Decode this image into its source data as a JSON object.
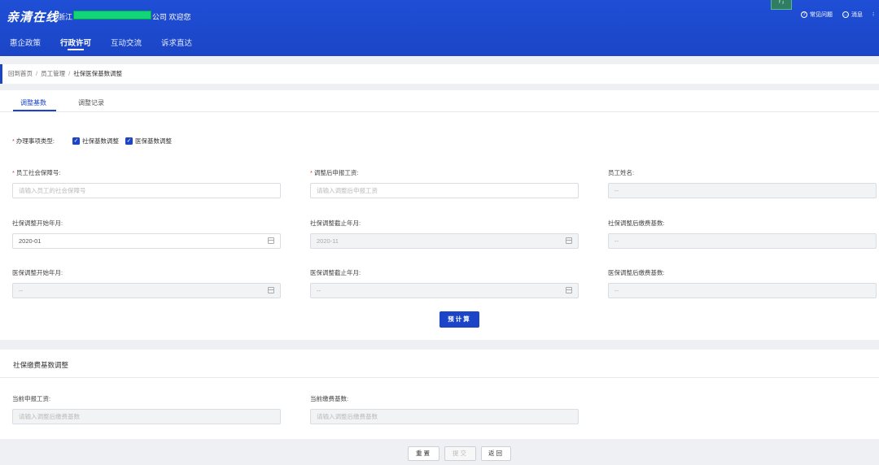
{
  "header": {
    "brand": "亲清在线",
    "dot": "•",
    "greeting_prefix": "浙江",
    "greeting_suffix": "公司 欢迎您",
    "links": [
      {
        "icon": "question-icon",
        "label": "常见问题"
      },
      {
        "icon": "message-icon",
        "label": "消息"
      }
    ],
    "floating_badge": "ᶠ ᶡ",
    "nav": [
      "惠企政策",
      "行政许可",
      "互动交流",
      "诉求直达"
    ],
    "nav_active": "行政许可"
  },
  "breadcrumb": {
    "items": [
      "回到首页",
      "员工管理",
      "社保医保基数调整"
    ],
    "separator": "/"
  },
  "tabs": [
    {
      "label": "调整基数",
      "active": true
    },
    {
      "label": "调整记录",
      "active": false
    }
  ],
  "form": {
    "type_label": "办理事项类型:",
    "checkboxes": [
      {
        "label": "社保基数调整",
        "checked": true
      },
      {
        "label": "医保基数调整",
        "checked": true
      }
    ],
    "ssn_label": "员工社会保障号:",
    "ssn_placeholder": "请输入员工的社会保障号",
    "wage_label": "调整后申报工资:",
    "wage_placeholder": "请输入调整后申报工资",
    "name_label": "员工姓名:",
    "name_value": "--",
    "si_start_label": "社保调整开始年月:",
    "si_start_value": "2020-01",
    "si_end_label": "社保调整截止年月:",
    "si_end_value": "2020-11",
    "si_base_label": "社保调整后缴费基数:",
    "si_base_value": "--",
    "mi_start_label": "医保调整开始年月:",
    "mi_start_value": "--",
    "mi_end_label": "医保调整截止年月:",
    "mi_end_value": "--",
    "mi_base_label": "医保调整后缴费基数:",
    "mi_base_value": "--",
    "calc_button": "预计算"
  },
  "section2": {
    "title": "社保缴费基数调整",
    "current_wage_label": "当前申报工资:",
    "current_wage_placeholder": "请输入调整后缴费基数",
    "current_base_label": "当前缴费基数:",
    "current_base_placeholder": "请输入调整后缴费基数"
  },
  "footer": {
    "reset": "重置",
    "submit": "提交",
    "back": "返回"
  },
  "colors": {
    "primary": "#1b45c6",
    "required": "#e53935",
    "redaction": "#12d57a"
  }
}
